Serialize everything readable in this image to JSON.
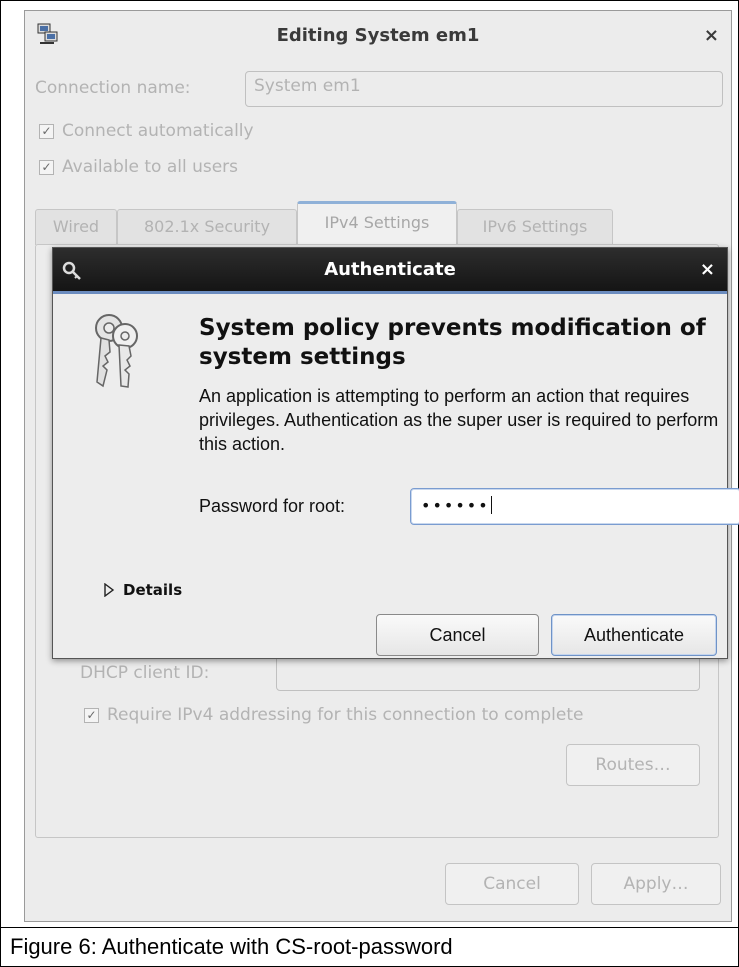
{
  "window": {
    "title": "Editing System em1",
    "close_glyph": "×",
    "icon": "network-connections-icon",
    "connection_name_label": "Connection name:",
    "connection_name_value": "System em1",
    "connect_automatically": "Connect automatically",
    "available_to_all_users": "Available to all users",
    "tabs": [
      {
        "label": "Wired"
      },
      {
        "label": "802.1x Security"
      },
      {
        "label": "IPv4 Settings",
        "active": true
      },
      {
        "label": "IPv6 Settings"
      }
    ],
    "dhcp_client_id_label": "DHCP client ID:",
    "require_ipv4": "Require IPv4 addressing for this connection to complete",
    "routes_button": "Routes…",
    "cancel_button": "Cancel",
    "apply_button": "Apply…",
    "check_glyph": "✓"
  },
  "auth_dialog": {
    "title": "Authenticate",
    "close_glyph": "×",
    "heading": "System policy prevents modification of system settings",
    "message": "An application is attempting to perform an action that requires privileges. Authentication as the super user is required to perform this action.",
    "password_label": "Password for root:",
    "password_mask": "••••••",
    "details_label": "Details",
    "cancel_button": "Cancel",
    "authenticate_button": "Authenticate",
    "icons": [
      "key-icon",
      "keys-icon",
      "expander-triangle-icon"
    ]
  },
  "caption": "Figure 6: Authenticate with CS-root-password"
}
